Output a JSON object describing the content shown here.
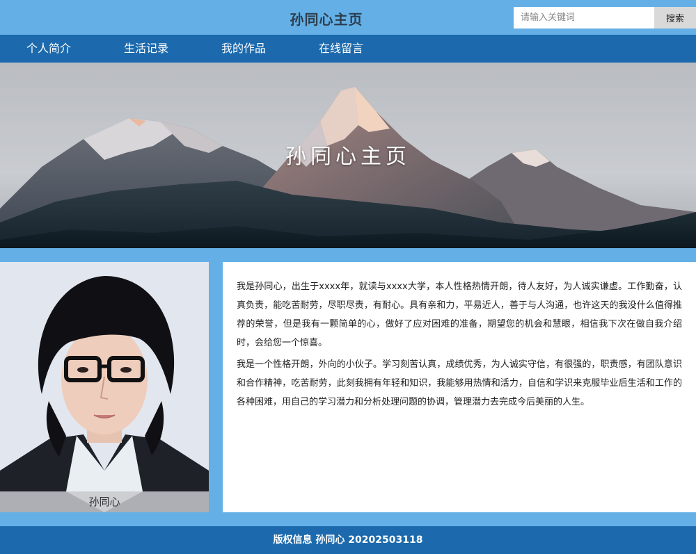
{
  "header": {
    "title": "孙同心主页",
    "search_placeholder": "请输入关键词",
    "search_button": "搜索"
  },
  "nav": {
    "items": [
      "个人简介",
      "生活记录",
      "我的作品",
      "在线留言"
    ]
  },
  "banner": {
    "title": "孙同心主页"
  },
  "profile": {
    "caption": "孙同心"
  },
  "intro": {
    "paragraphs": [
      "我是孙同心，出生于xxxx年，就读与xxxx大学，本人性格热情开朗，待人友好，为人诚实谦虚。工作勤奋，认真负责，能吃苦耐劳，尽职尽责，有耐心。具有亲和力，平易近人，善于与人沟通，也许这天的我没什么值得推荐的荣誉，但是我有一颗简单的心，做好了应对困难的准备，期望您的机会和慧眼，相信我下次在做自我介绍时，会给您一个惊喜。",
      "我是一个性格开朗，外向的小伙子。学习刻苦认真，成绩优秀，为人诚实守信，有很强的，职责感，有团队意识和合作精神，吃苦耐劳，此刻我拥有年轻和知识，我能够用热情和活力，自信和学识来克服毕业后生活和工作的各种困难，用自己的学习潜力和分析处理问题的协调，管理潜力去完成今后美丽的人生。"
    ]
  },
  "footer": {
    "text": "版权信息 孙同心 20202503118"
  },
  "colors": {
    "page_background": "#64b0e6",
    "nav_background": "#1c6aad",
    "footer_background": "#1c6aad"
  }
}
